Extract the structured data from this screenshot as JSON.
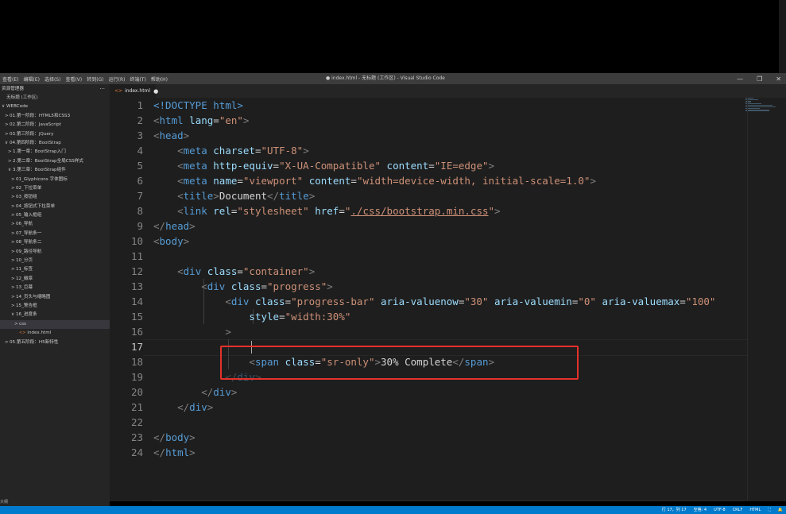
{
  "menu": [
    "查看(E)",
    "编辑(E)",
    "选择(S)",
    "查看(V)",
    "转到(G)",
    "运行(R)",
    "终端(T)",
    "帮助(H)"
  ],
  "window_title": "● index.html - 无标题 (工作区) - Visual Studio Code",
  "window_controls": {
    "minimize": "—",
    "restore": "❐",
    "close": "✕"
  },
  "sidebar": {
    "header": "资源管理器",
    "more": "···",
    "tree": [
      {
        "label": "无标题 (工作区)",
        "indent": 0,
        "twisty": ""
      },
      {
        "label": "WEBCode",
        "indent": 0,
        "twisty": "∨"
      },
      {
        "label": "01.第一阶段：HTML5和CSS3",
        "indent": 1,
        "twisty": ">"
      },
      {
        "label": "02.第二阶段：JavaScript",
        "indent": 1,
        "twisty": ">"
      },
      {
        "label": "03.第三阶段：jQuery",
        "indent": 1,
        "twisty": ">"
      },
      {
        "label": "04.第四阶段：BootStrap",
        "indent": 1,
        "twisty": "∨"
      },
      {
        "label": "1.第一章：BootStrap入门",
        "indent": 2,
        "twisty": ">"
      },
      {
        "label": "2.第二章：BootStrap全局CSS样式",
        "indent": 2,
        "twisty": ">"
      },
      {
        "label": "3.第三章：BootStrap组件",
        "indent": 2,
        "twisty": "∨"
      },
      {
        "label": "01_Glyphicons 字体图标",
        "indent": 3,
        "twisty": ">"
      },
      {
        "label": "02_下拉菜单",
        "indent": 3,
        "twisty": ">"
      },
      {
        "label": "03_按钮组",
        "indent": 3,
        "twisty": ">"
      },
      {
        "label": "04_按钮式下拉菜单",
        "indent": 3,
        "twisty": ">"
      },
      {
        "label": "05_输入框组",
        "indent": 3,
        "twisty": ">"
      },
      {
        "label": "06_导航",
        "indent": 3,
        "twisty": ">"
      },
      {
        "label": "07_导航条一",
        "indent": 3,
        "twisty": ">"
      },
      {
        "label": "08_导航条二",
        "indent": 3,
        "twisty": ">"
      },
      {
        "label": "09_路径导航",
        "indent": 3,
        "twisty": ">"
      },
      {
        "label": "10_分页",
        "indent": 3,
        "twisty": ">"
      },
      {
        "label": "11_标签",
        "indent": 3,
        "twisty": ">"
      },
      {
        "label": "12_徽章",
        "indent": 3,
        "twisty": ">"
      },
      {
        "label": "13_巨幕",
        "indent": 3,
        "twisty": ">"
      },
      {
        "label": "14_页头与缩略图",
        "indent": 3,
        "twisty": ">"
      },
      {
        "label": "15_警告框",
        "indent": 3,
        "twisty": ">"
      },
      {
        "label": "16_进度条",
        "indent": 3,
        "twisty": "∨"
      },
      {
        "label": "css",
        "indent": 4,
        "twisty": ">",
        "selected": true
      },
      {
        "label": "index.html",
        "indent": 4,
        "twisty": "",
        "file": true
      },
      {
        "label": "05.第五阶段：H5新特性",
        "indent": 1,
        "twisty": ">"
      }
    ],
    "bottom": "大纲"
  },
  "tab": {
    "label": "index.html",
    "dirty": "●"
  },
  "editor": {
    "current_line": 17,
    "lines": [
      [
        [
          "d",
          "<!DOCTYPE "
        ],
        [
          "t",
          "html"
        ],
        [
          "d",
          ">"
        ]
      ],
      [
        [
          "p",
          "<"
        ],
        [
          "t",
          "html"
        ],
        [
          "a",
          " lang"
        ],
        [
          "x",
          "="
        ],
        [
          "s",
          "\"en\""
        ],
        [
          "p",
          ">"
        ]
      ],
      [
        [
          "p",
          "<"
        ],
        [
          "t",
          "head"
        ],
        [
          "p",
          ">"
        ]
      ],
      [
        [
          "x",
          "    "
        ],
        [
          "p",
          "<"
        ],
        [
          "t",
          "meta"
        ],
        [
          "a",
          " charset"
        ],
        [
          "x",
          "="
        ],
        [
          "s",
          "\"UTF-8\""
        ],
        [
          "p",
          ">"
        ]
      ],
      [
        [
          "x",
          "    "
        ],
        [
          "p",
          "<"
        ],
        [
          "t",
          "meta"
        ],
        [
          "a",
          " http-equiv"
        ],
        [
          "x",
          "="
        ],
        [
          "s",
          "\"X-UA-Compatible\""
        ],
        [
          "a",
          " content"
        ],
        [
          "x",
          "="
        ],
        [
          "s",
          "\"IE=edge\""
        ],
        [
          "p",
          ">"
        ]
      ],
      [
        [
          "x",
          "    "
        ],
        [
          "p",
          "<"
        ],
        [
          "t",
          "meta"
        ],
        [
          "a",
          " name"
        ],
        [
          "x",
          "="
        ],
        [
          "s",
          "\"viewport\""
        ],
        [
          "a",
          " content"
        ],
        [
          "x",
          "="
        ],
        [
          "s",
          "\"width=device-width, initial-scale=1.0\""
        ],
        [
          "p",
          ">"
        ]
      ],
      [
        [
          "x",
          "    "
        ],
        [
          "p",
          "<"
        ],
        [
          "t",
          "title"
        ],
        [
          "p",
          ">"
        ],
        [
          "x",
          "Document"
        ],
        [
          "p",
          "</"
        ],
        [
          "t",
          "title"
        ],
        [
          "p",
          ">"
        ]
      ],
      [
        [
          "x",
          "    "
        ],
        [
          "p",
          "<"
        ],
        [
          "t",
          "link"
        ],
        [
          "a",
          " rel"
        ],
        [
          "x",
          "="
        ],
        [
          "s",
          "\"stylesheet\""
        ],
        [
          "a",
          " href"
        ],
        [
          "x",
          "="
        ],
        [
          "s",
          "\""
        ],
        [
          "su",
          "./css/bootstrap.min.css"
        ],
        [
          "s",
          "\""
        ],
        [
          "p",
          ">"
        ]
      ],
      [
        [
          "p",
          "</"
        ],
        [
          "t",
          "head"
        ],
        [
          "p",
          ">"
        ]
      ],
      [
        [
          "p",
          "<"
        ],
        [
          "t",
          "body"
        ],
        [
          "p",
          ">"
        ]
      ],
      [],
      [
        [
          "x",
          "    "
        ],
        [
          "p",
          "<"
        ],
        [
          "t",
          "div"
        ],
        [
          "a",
          " class"
        ],
        [
          "x",
          "="
        ],
        [
          "s",
          "\"container\""
        ],
        [
          "p",
          ">"
        ]
      ],
      [
        [
          "x",
          "        "
        ],
        [
          "p",
          "<"
        ],
        [
          "t",
          "div"
        ],
        [
          "a",
          " class"
        ],
        [
          "x",
          "="
        ],
        [
          "s",
          "\"progress\""
        ],
        [
          "p",
          ">"
        ]
      ],
      [
        [
          "x",
          "            "
        ],
        [
          "p",
          "<"
        ],
        [
          "t",
          "div"
        ],
        [
          "a",
          " class"
        ],
        [
          "x",
          "="
        ],
        [
          "s",
          "\"progress-bar\""
        ],
        [
          "a",
          " aria-valuenow"
        ],
        [
          "x",
          "="
        ],
        [
          "s",
          "\"30\""
        ],
        [
          "a",
          " aria-valuemin"
        ],
        [
          "x",
          "="
        ],
        [
          "s",
          "\"0\""
        ],
        [
          "a",
          " aria-valuemax"
        ],
        [
          "x",
          "="
        ],
        [
          "s",
          "\"100\""
        ]
      ],
      [
        [
          "x",
          "                "
        ],
        [
          "a",
          "style"
        ],
        [
          "x",
          "="
        ],
        [
          "s",
          "\"width:30%\""
        ]
      ],
      [
        [
          "x",
          "            "
        ],
        [
          "p",
          ">"
        ]
      ],
      [],
      [
        [
          "x",
          "                "
        ],
        [
          "p",
          "<"
        ],
        [
          "t",
          "span"
        ],
        [
          "a",
          " class"
        ],
        [
          "x",
          "="
        ],
        [
          "s",
          "\"sr-only\""
        ],
        [
          "p",
          ">"
        ],
        [
          "x",
          "30% Complete"
        ],
        [
          "p",
          "</"
        ],
        [
          "t",
          "span"
        ],
        [
          "p",
          ">"
        ]
      ],
      [
        [
          "x",
          "            "
        ],
        [
          "pd",
          "</"
        ],
        [
          "td",
          "div"
        ],
        [
          "pd",
          ">"
        ]
      ],
      [
        [
          "x",
          "        "
        ],
        [
          "p",
          "</"
        ],
        [
          "t",
          "div"
        ],
        [
          "p",
          ">"
        ]
      ],
      [
        [
          "x",
          "    "
        ],
        [
          "p",
          "</"
        ],
        [
          "t",
          "div"
        ],
        [
          "p",
          ">"
        ]
      ],
      [],
      [
        [
          "p",
          "</"
        ],
        [
          "t",
          "body"
        ],
        [
          "p",
          ">"
        ]
      ],
      [
        [
          "p",
          "</"
        ],
        [
          "t",
          "html"
        ],
        [
          "p",
          ">"
        ]
      ]
    ]
  },
  "status": {
    "position": "行 17，列 17",
    "spaces": "空格: 4",
    "encoding": "UTF-8",
    "eol": "CRLF",
    "language": "HTML",
    "feedback": "⛶",
    "bell": "🔔"
  },
  "colors": {
    "accent": "#007acc",
    "highlight_box": "#e5312a",
    "editor_bg": "#1e1e1e",
    "sidebar_bg": "#252526"
  }
}
